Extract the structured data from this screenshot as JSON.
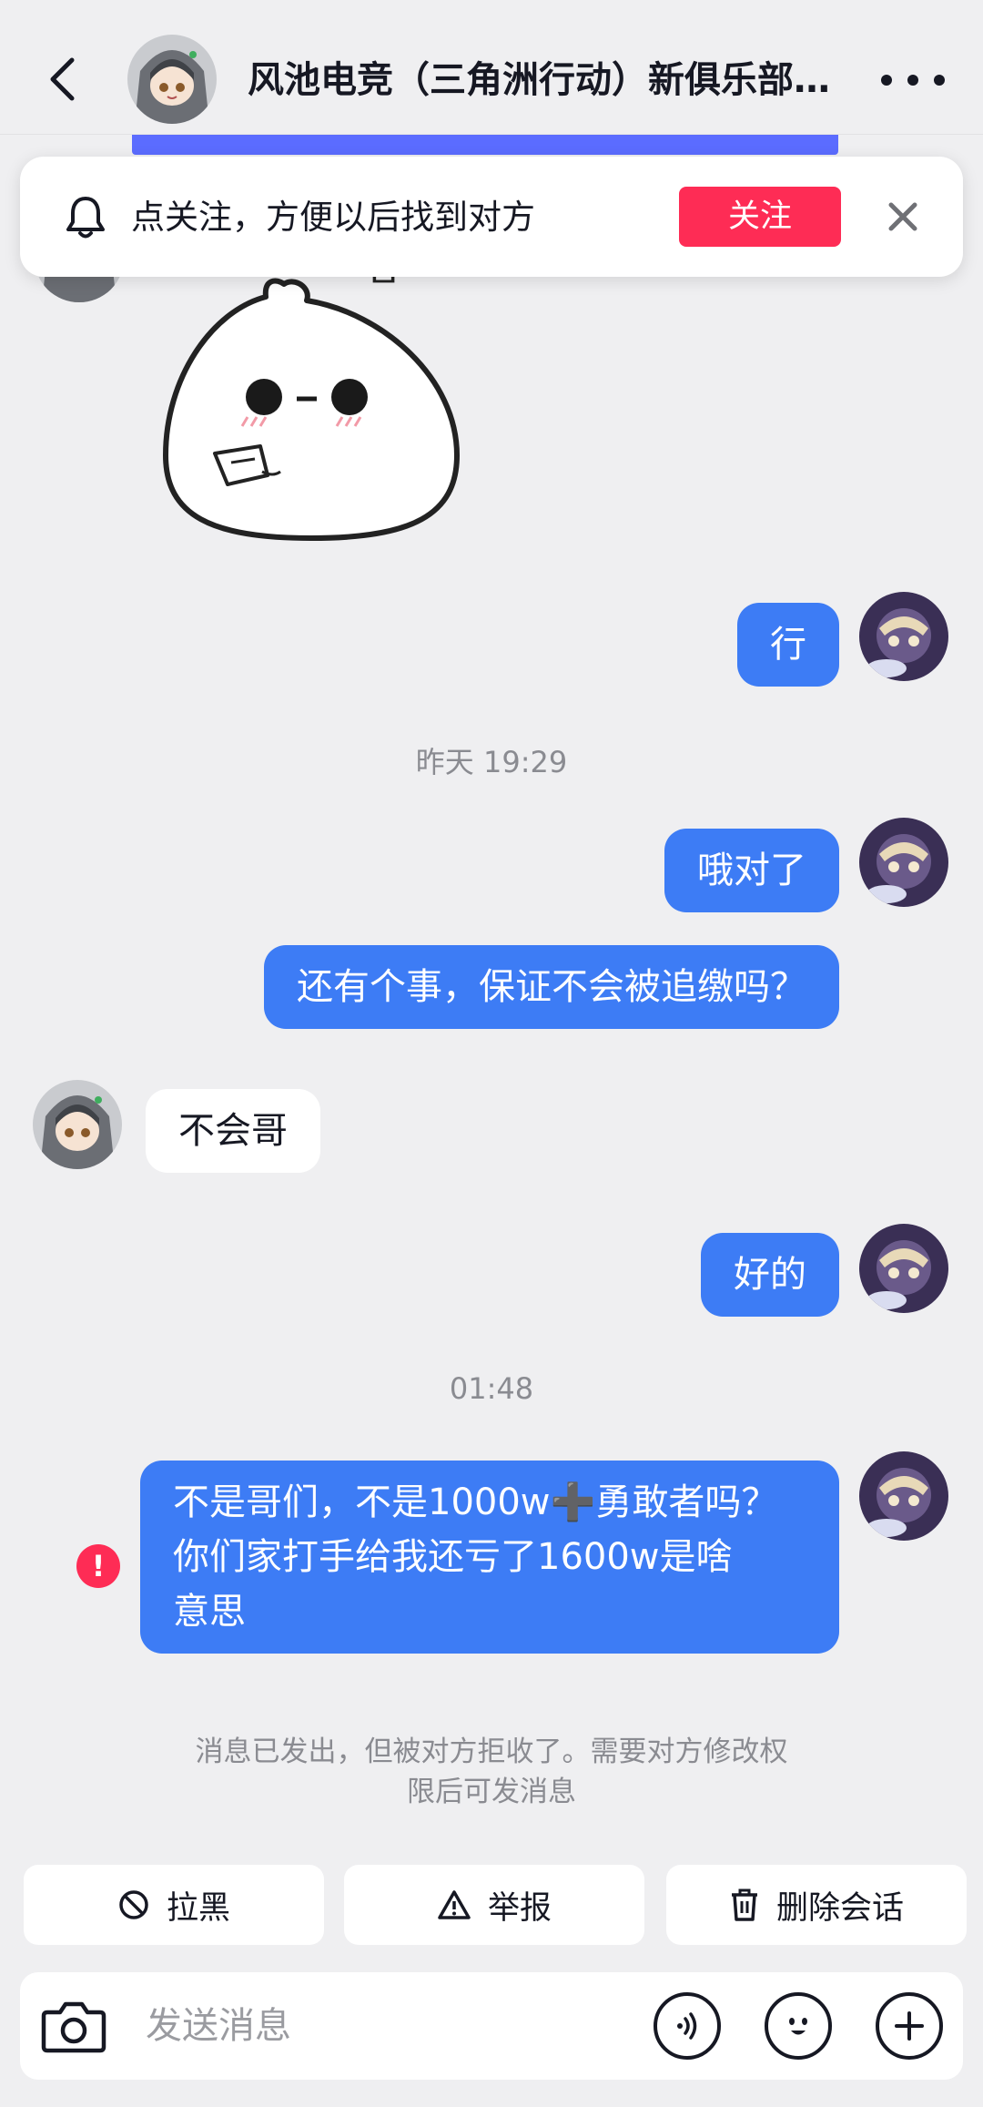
{
  "header": {
    "title": "风池电竞（三角洲行动）新俱乐部…"
  },
  "banner": {
    "text": "点关注，方便以后找到对方",
    "follow_label": "关注"
  },
  "messages": {
    "m1": "行",
    "t1": "昨天 19:29",
    "m2": "哦对了",
    "m3": "还有个事，保证不会被追缴吗？",
    "m4": "不会哥",
    "m5": "好的",
    "t2": "01:48",
    "m6_line1": "不是哥们，不是1000w➕勇敢者吗？",
    "m6_line2": "你们家打手给我还亏了1600w是啥",
    "m6_line3": "意思"
  },
  "failed_icon": "!",
  "notice": {
    "line1": "消息已发出，但被对方拒收了。需要对方修改权",
    "line2": "限后可发消息"
  },
  "actions": {
    "block": "拉黑",
    "report": "举报",
    "delete": "删除会话"
  },
  "input": {
    "placeholder": "发送消息"
  },
  "colors": {
    "my_bubble": "#3d7cf5",
    "accent": "#fe2c55",
    "background": "#efeff1"
  }
}
